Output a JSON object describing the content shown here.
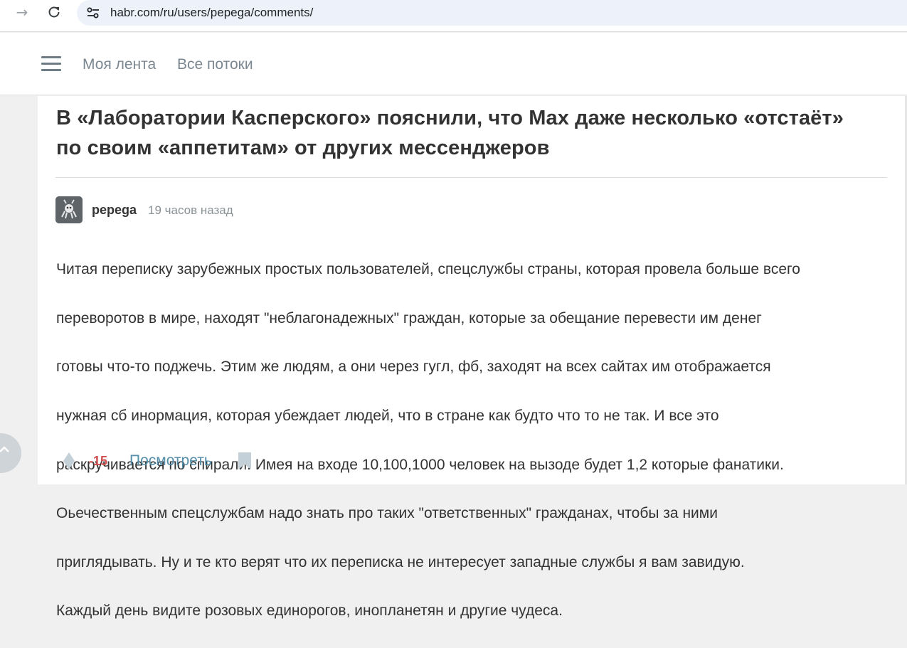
{
  "browser": {
    "url": "habr.com/ru/users/pepega/comments/",
    "icons": {
      "back": "arrow-right-icon",
      "reload": "reload-icon",
      "site_info": "tune-icon"
    }
  },
  "header": {
    "menu_icon": "hamburger-icon",
    "nav": [
      {
        "label": "Моя лента"
      },
      {
        "label": "Все потоки"
      }
    ]
  },
  "post": {
    "title": "В «Лаборатории Касперского» пояснили, что Max даже несколько «отстаёт» по своим «аппетитам» от других мессенджеров"
  },
  "comment": {
    "author": "pepega",
    "time": "19 часов назад",
    "lines": [
      "Читая переписку зарубежных простых пользователей, спецслужбы страны, которая провела больше всего",
      "переворотов в мире, находят \"неблагонадежных\" граждан, которые за обещание перевести им денег",
      "готовы что-то поджечь. Этим же людям, а они через гугл, фб, заходят на всех сайтах им отображается",
      "нужная сб инормация, которая убеждает людей, что в стране как будто что то не так. И все это",
      "раскручивается по спирали. Имея на входе 10,100,1000 человек на вызоде будет 1,2 которые фанатики.",
      "Оьечественным спецслужбам надо знать про таких \"ответственных\" гражданах, чтобы за ними",
      "приглядывать. Ну и те кто верят что их переписка не интересует западные службы я вам завидую.",
      "Каждый день видите розовых единорогов, инопланетян и другие чудеса."
    ],
    "score": "-15",
    "view_label": "Посмотреть",
    "colors": {
      "score": "#d04e4e",
      "link": "#548eaa"
    }
  },
  "scroll_up_icon": "chevron-up-icon"
}
